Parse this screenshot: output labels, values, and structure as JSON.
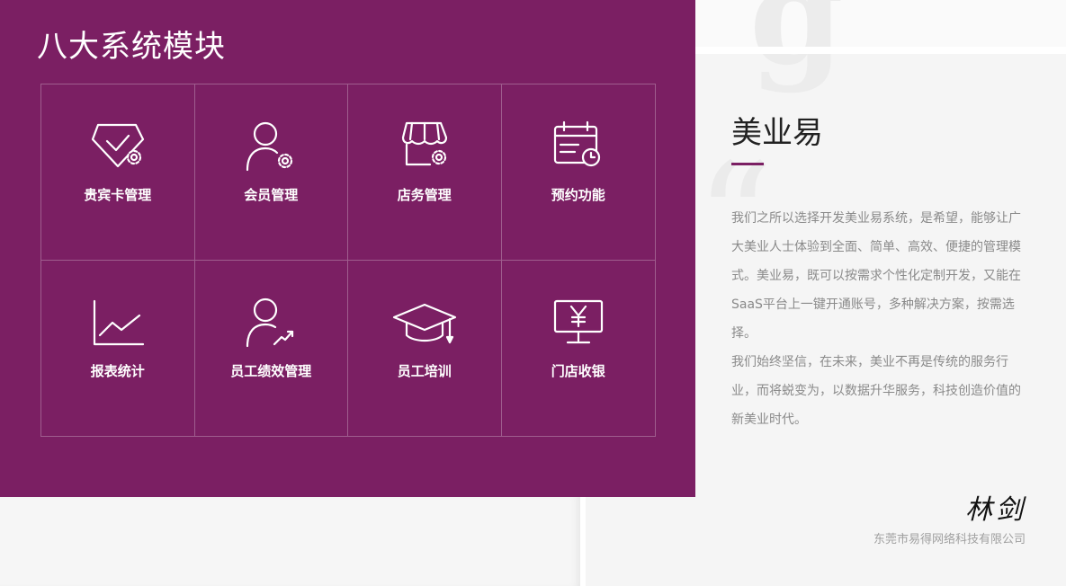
{
  "modules": {
    "title": "八大系统模块",
    "items": [
      {
        "label": "贵宾卡管理",
        "icon": "diamond-gear-icon"
      },
      {
        "label": "会员管理",
        "icon": "user-gear-icon"
      },
      {
        "label": "店务管理",
        "icon": "store-gear-icon"
      },
      {
        "label": "预约功能",
        "icon": "calendar-clock-icon"
      },
      {
        "label": "报表统计",
        "icon": "line-chart-icon"
      },
      {
        "label": "员工绩效管理",
        "icon": "user-trend-icon"
      },
      {
        "label": "员工培训",
        "icon": "graduation-cap-icon"
      },
      {
        "label": "门店收银",
        "icon": "cash-register-icon"
      }
    ]
  },
  "about": {
    "title": "美业易",
    "paragraphs": [
      "我们之所以选择开发美业易系统，是希望，能够让广大美业人士体验到全面、简单、高效、便捷的管理模式。美业易，既可以按需求个性化定制开发，又能在SaaS平台上一键开通账号，多种解决方案，按需选择。",
      "我们始终坚信，在未来，美业不再是传统的服务行业，而将蜕变为，以数据升华服务，科技创造价值的新美业时代。"
    ],
    "signature": "林剑",
    "company": "东莞市易得网络科技有限公司"
  },
  "colors": {
    "accent": "#7b1f63",
    "panel_text": "#ffffff",
    "body_text": "#8a8a8a"
  }
}
